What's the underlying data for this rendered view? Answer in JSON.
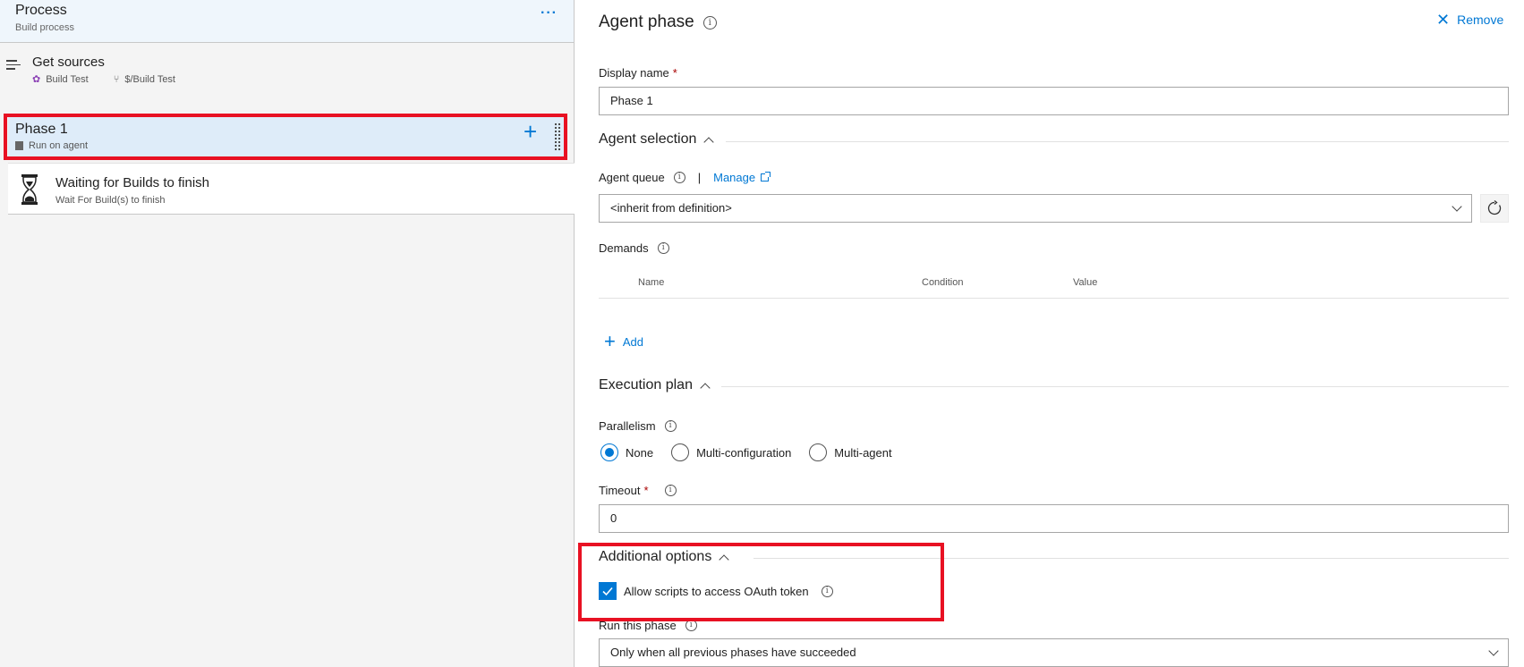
{
  "process": {
    "title": "Process",
    "subtitle": "Build process",
    "more_label": "···"
  },
  "get_sources": {
    "title": "Get sources",
    "repo": "Build Test",
    "branch": "$/Build Test"
  },
  "phase": {
    "title": "Phase 1",
    "subtitle": "Run on agent",
    "add_label": "+"
  },
  "task": {
    "title": "Waiting for Builds to finish",
    "subtitle": "Wait For Build(s) to finish"
  },
  "panel": {
    "title": "Agent phase",
    "remove_label": "Remove",
    "display_name": {
      "label": "Display name",
      "required": "*",
      "value": "Phase 1"
    },
    "agent_selection": {
      "heading": "Agent selection",
      "queue_label": "Agent queue",
      "separator": "|",
      "manage_label": "Manage",
      "queue_value": "<inherit from definition>",
      "demands_label": "Demands",
      "columns": [
        "Name",
        "Condition",
        "Value"
      ],
      "add_label": "Add"
    },
    "execution_plan": {
      "heading": "Execution plan",
      "parallelism_label": "Parallelism",
      "options": [
        "None",
        "Multi-configuration",
        "Multi-agent"
      ],
      "selected": "None",
      "timeout_label": "Timeout",
      "timeout_required": "*",
      "timeout_value": "0"
    },
    "additional_options": {
      "heading": "Additional options",
      "oauth_label": "Allow scripts to access OAuth token",
      "oauth_checked": true,
      "run_phase_label": "Run this phase",
      "run_phase_value": "Only when all previous phases have succeeded"
    }
  },
  "colors": {
    "accent": "#0078d4",
    "highlight": "#e81123",
    "selected_row": "#deecf9"
  }
}
